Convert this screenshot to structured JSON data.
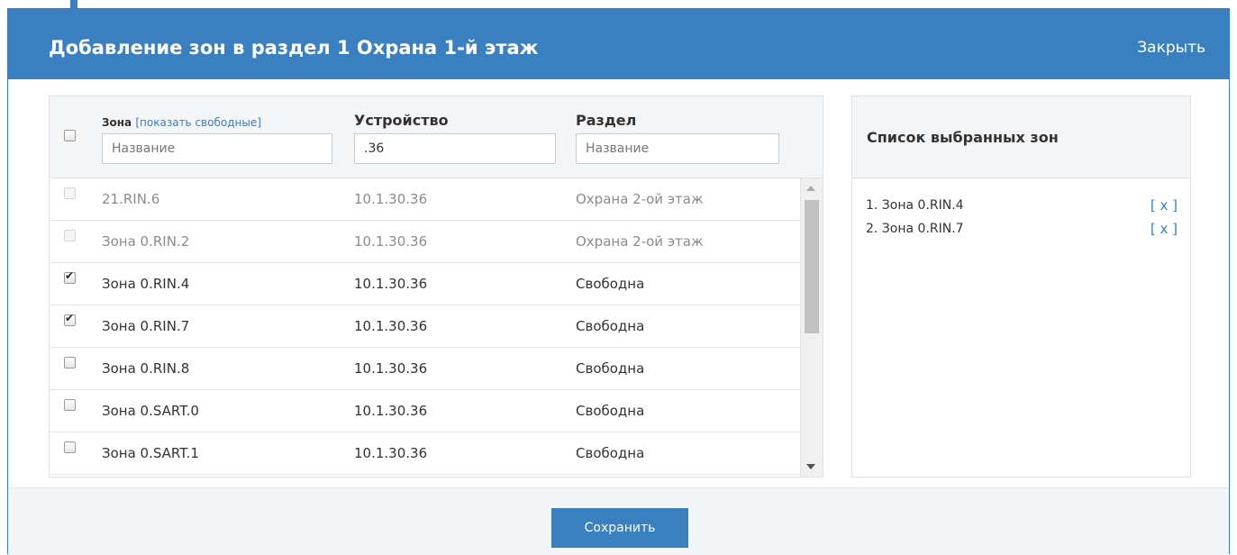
{
  "modal": {
    "title": "Добавление зон в раздел 1 Охрана 1-й этаж",
    "close_label": "Закрыть"
  },
  "table": {
    "columns": {
      "zone": "Зона",
      "show_free": "[показать свободные]",
      "device": "Устройство",
      "section": "Раздел"
    },
    "filters": {
      "zone_placeholder": "Название",
      "device_value": ".36",
      "section_placeholder": "Название"
    },
    "rows": [
      {
        "zone": "21.RIN.6",
        "device": "10.1.30.36",
        "section": "Охрана 2-ой этаж",
        "checked": false,
        "disabled": true
      },
      {
        "zone": "Зона 0.RIN.2",
        "device": "10.1.30.36",
        "section": "Охрана 2-ой этаж",
        "checked": false,
        "disabled": true
      },
      {
        "zone": "Зона 0.RIN.4",
        "device": "10.1.30.36",
        "section": "Свободна",
        "checked": true,
        "disabled": false
      },
      {
        "zone": "Зона 0.RIN.7",
        "device": "10.1.30.36",
        "section": "Свободна",
        "checked": true,
        "disabled": false
      },
      {
        "zone": "Зона 0.RIN.8",
        "device": "10.1.30.36",
        "section": "Свободна",
        "checked": false,
        "disabled": false
      },
      {
        "zone": "Зона 0.SART.0",
        "device": "10.1.30.36",
        "section": "Свободна",
        "checked": false,
        "disabled": false
      },
      {
        "zone": "Зона 0.SART.1",
        "device": "10.1.30.36",
        "section": "Свободна",
        "checked": false,
        "disabled": false
      }
    ]
  },
  "selected": {
    "title": "Список выбранных зон",
    "remove_label": "[ x ]",
    "items": [
      {
        "label": "1. Зона 0.RIN.4"
      },
      {
        "label": "2. Зона 0.RIN.7"
      }
    ]
  },
  "footer": {
    "save_label": "Сохранить"
  },
  "colors": {
    "accent": "#3a7fc0",
    "header_bg": "#3a7fc0",
    "panel_head_bg": "#f4f5f7",
    "disabled_text": "#8c8c8c"
  }
}
